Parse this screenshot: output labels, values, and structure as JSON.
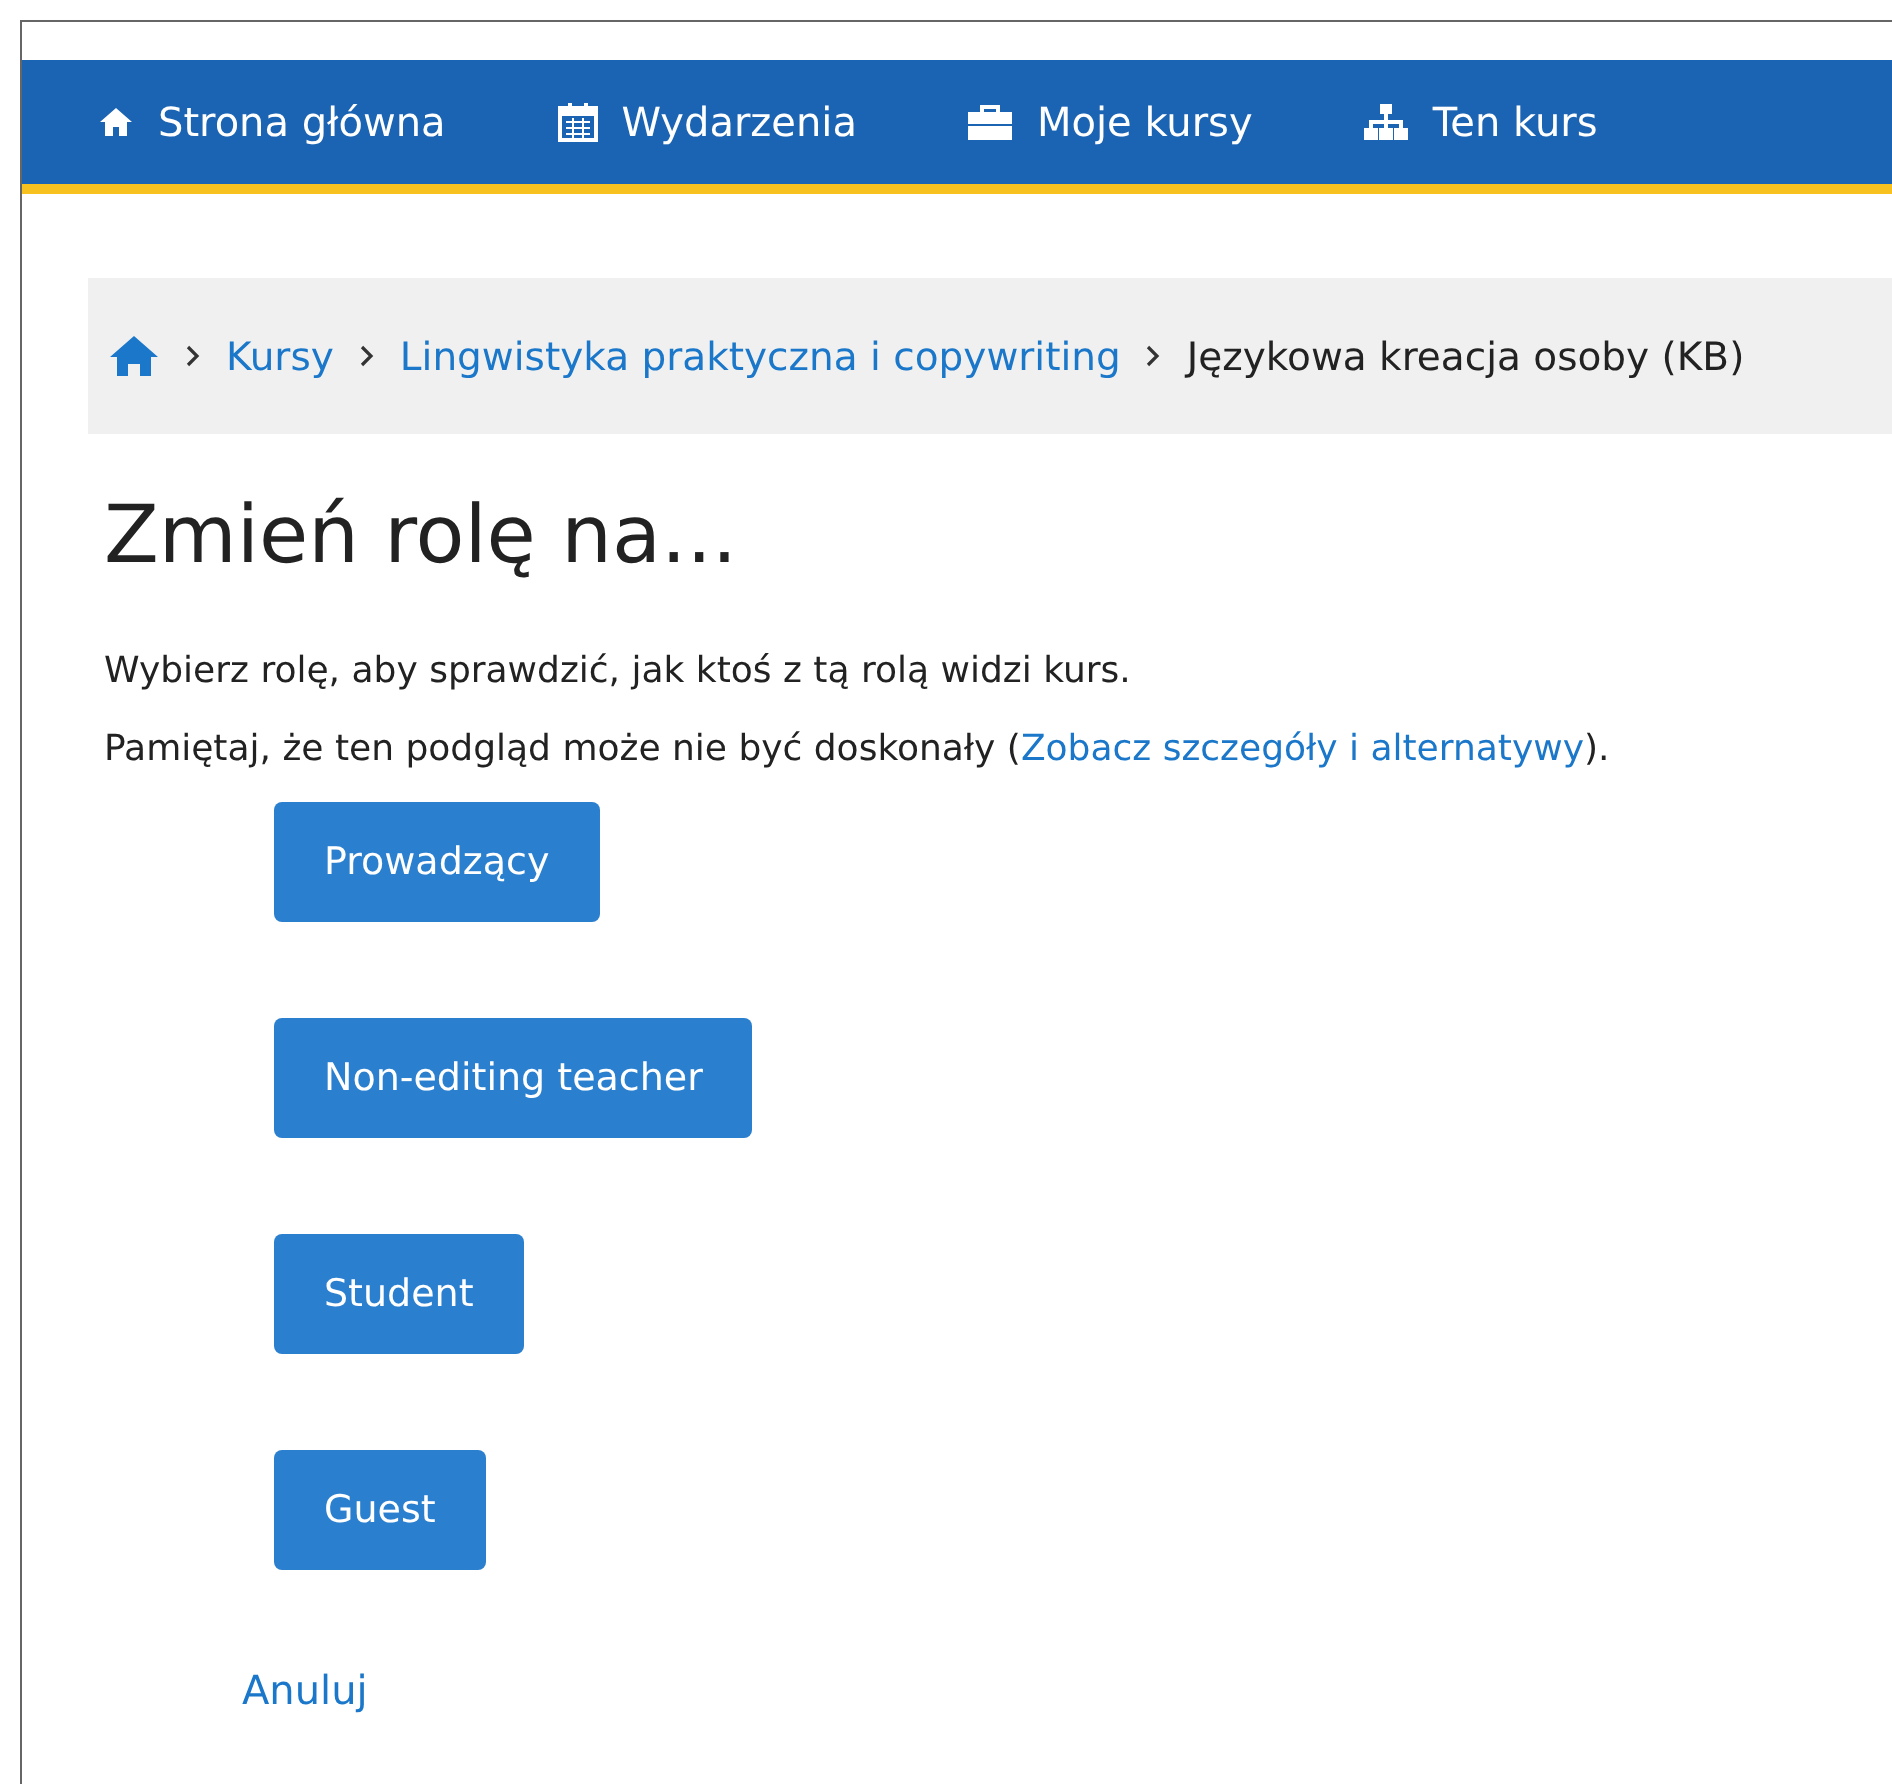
{
  "nav": [
    {
      "label": "Strona główna"
    },
    {
      "label": "Wydarzenia"
    },
    {
      "label": "Moje kursy"
    },
    {
      "label": "Ten kurs"
    }
  ],
  "breadcrumb": [
    {
      "label": "Kursy",
      "link": true
    },
    {
      "label": "Lingwistyka praktyczna i copywriting",
      "link": true
    },
    {
      "label": "Językowa kreacja osoby (KB)",
      "link": false
    }
  ],
  "heading": "Zmień rolę na...",
  "intro": "Wybierz rolę, aby sprawdzić, jak ktoś z tą rolą widzi kurs.",
  "note": {
    "before": "Pamiętaj, że ten podgląd może nie być doskonały (",
    "link": "Zobacz szczegóły i alternatywy",
    "after": ")."
  },
  "roles": [
    "Prowadzący",
    "Non-editing teacher",
    "Student",
    "Guest"
  ],
  "cancel": "Anuluj"
}
